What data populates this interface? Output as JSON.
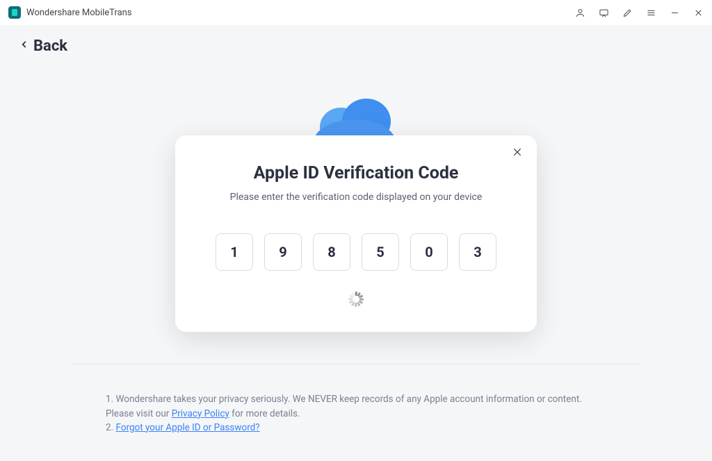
{
  "app": {
    "title": "Wondershare MobileTrans"
  },
  "back": {
    "label": "Back"
  },
  "modal": {
    "title": "Apple ID  Verification Code",
    "subtitle": "Please enter the verification code displayed on your device",
    "code": [
      "1",
      "9",
      "8",
      "5",
      "0",
      "3"
    ]
  },
  "footer": {
    "line1_prefix": "1. Wondershare takes your privacy seriously. We NEVER keep records of any Apple account information or content. Please visit our ",
    "privacy_link": " Privacy Policy",
    "line1_suffix": " for more details.",
    "line2_prefix": "2. ",
    "forgot_link": "Forgot your Apple ID or Password?"
  }
}
